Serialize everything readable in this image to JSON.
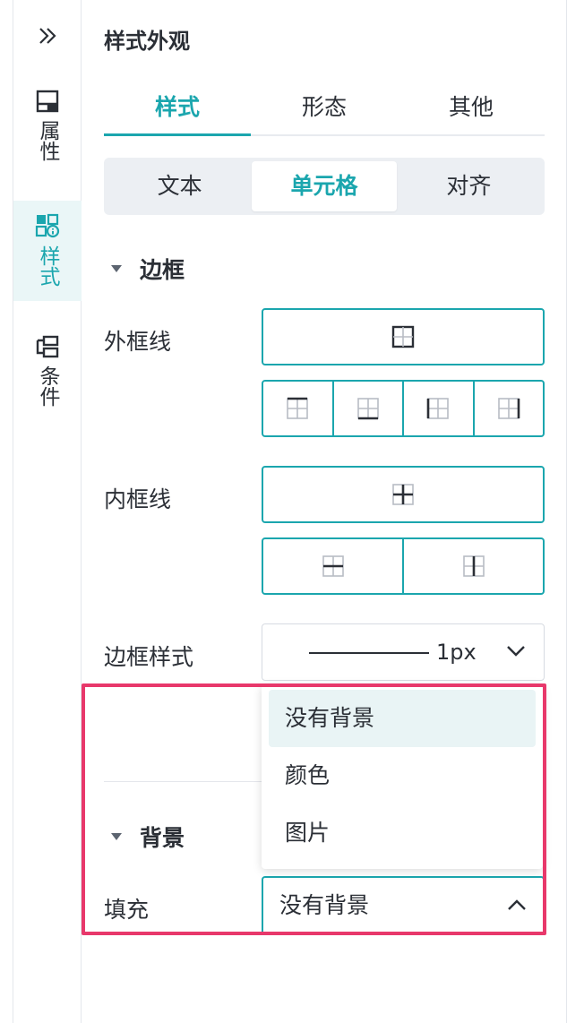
{
  "rail": {
    "items": [
      {
        "label": "属性",
        "icon": "table-layout-icon"
      },
      {
        "label": "样式",
        "icon": "style-grid-icon"
      },
      {
        "label": "条件",
        "icon": "condition-icon"
      }
    ]
  },
  "panel": {
    "title": "样式外观",
    "tabs": [
      "样式",
      "形态",
      "其他"
    ],
    "active_tab": "样式",
    "segments": [
      "文本",
      "单元格",
      "对齐"
    ],
    "active_segment": "单元格"
  },
  "border_section": {
    "heading": "边框",
    "outer_label": "外框线",
    "inner_label": "内框线",
    "style_label": "边框样式",
    "style_value": "1px"
  },
  "background_section": {
    "heading": "背景",
    "fill_label": "填充",
    "fill_value": "没有背景",
    "options": [
      "没有背景",
      "颜色",
      "图片"
    ],
    "selected_option": "没有背景"
  },
  "colors": {
    "accent": "#1ba6ae",
    "highlight": "#e8386b",
    "text": "#2b2f36"
  }
}
